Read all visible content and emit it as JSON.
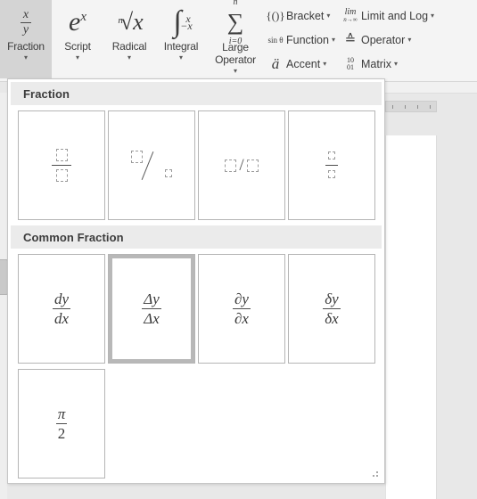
{
  "ribbon": {
    "big_buttons": [
      {
        "name": "fraction",
        "label": "Fraction",
        "glyph_num": "x",
        "glyph_den": "y",
        "caret": "▾",
        "active": true
      },
      {
        "name": "script",
        "label": "Script",
        "glyph": "e",
        "glyph_sup": "x",
        "caret": "▾",
        "active": false
      },
      {
        "name": "radical",
        "label": "Radical",
        "glyph_deg": "n",
        "glyph": "√x",
        "caret": "▾",
        "active": false
      },
      {
        "name": "integral",
        "label": "Integral",
        "glyph": "∫",
        "lim_top": "x",
        "lim_bottom": "−x",
        "caret": "▾",
        "active": false
      },
      {
        "name": "large-operator",
        "label": "Large Operator",
        "glyph": "∑",
        "lim_top": "n",
        "lim_bottom": "i=0",
        "caret": "▾",
        "active": false
      }
    ],
    "small_buttons_col1": [
      {
        "name": "bracket",
        "label": "Bracket",
        "icon": "{()}",
        "caret": "▾"
      },
      {
        "name": "function",
        "label": "Function",
        "icon": "sin θ",
        "caret": "▾"
      },
      {
        "name": "accent",
        "label": "Accent",
        "icon": "ä",
        "caret": "▾"
      }
    ],
    "small_buttons_col2": [
      {
        "name": "limit-and-log",
        "label": "Limit and Log",
        "icon_main": "lim",
        "icon_sub": "n→∞",
        "caret": "▾"
      },
      {
        "name": "operator",
        "label": "Operator",
        "icon": "≙",
        "caret": "▾"
      },
      {
        "name": "matrix",
        "label": "Matrix",
        "icon_top": "10",
        "icon_bottom": "01",
        "caret": "▾"
      }
    ]
  },
  "gallery": {
    "sections": [
      {
        "name": "fraction",
        "header": "Fraction",
        "tiles": [
          {
            "name": "stacked-fraction",
            "kind": "stack-ph",
            "label": "Stacked Fraction",
            "selected": false
          },
          {
            "name": "skewed-fraction",
            "kind": "skew-ph",
            "label": "Skewed Fraction",
            "selected": false
          },
          {
            "name": "linear-fraction",
            "kind": "linear-ph",
            "label": "Linear Fraction",
            "selected": false
          },
          {
            "name": "small-stacked-fraction",
            "kind": "stack-ph-small",
            "label": "Small Stacked Fraction",
            "selected": false
          }
        ]
      },
      {
        "name": "common-fraction",
        "header": "Common Fraction",
        "tiles": [
          {
            "name": "dy-dx",
            "kind": "frac",
            "num": "dy",
            "den": "dx",
            "selected": false
          },
          {
            "name": "delta-y-delta-x",
            "kind": "frac",
            "num": "Δy",
            "den": "Δx",
            "selected": true
          },
          {
            "name": "partial-y-partial-x",
            "kind": "frac",
            "num": "∂y",
            "den": "∂x",
            "selected": false
          },
          {
            "name": "small-delta-y-small-delta-x",
            "kind": "frac",
            "num": "δy",
            "den": "δx",
            "selected": false
          },
          {
            "name": "pi-over-2",
            "kind": "frac",
            "num": "π",
            "den": "2",
            "selected": false
          }
        ]
      }
    ],
    "resize_grip": "resize-grip"
  },
  "colors": {
    "ribbon_background": "#f4f4f4",
    "app_background": "#e8e8e8",
    "section_header_background": "#ebebeb",
    "active_button_background": "#d4d4d4",
    "selection_border": "#b8b8b8",
    "tile_border": "#b5b5b5",
    "text": "#3b3b3b",
    "page_white": "#ffffff"
  }
}
